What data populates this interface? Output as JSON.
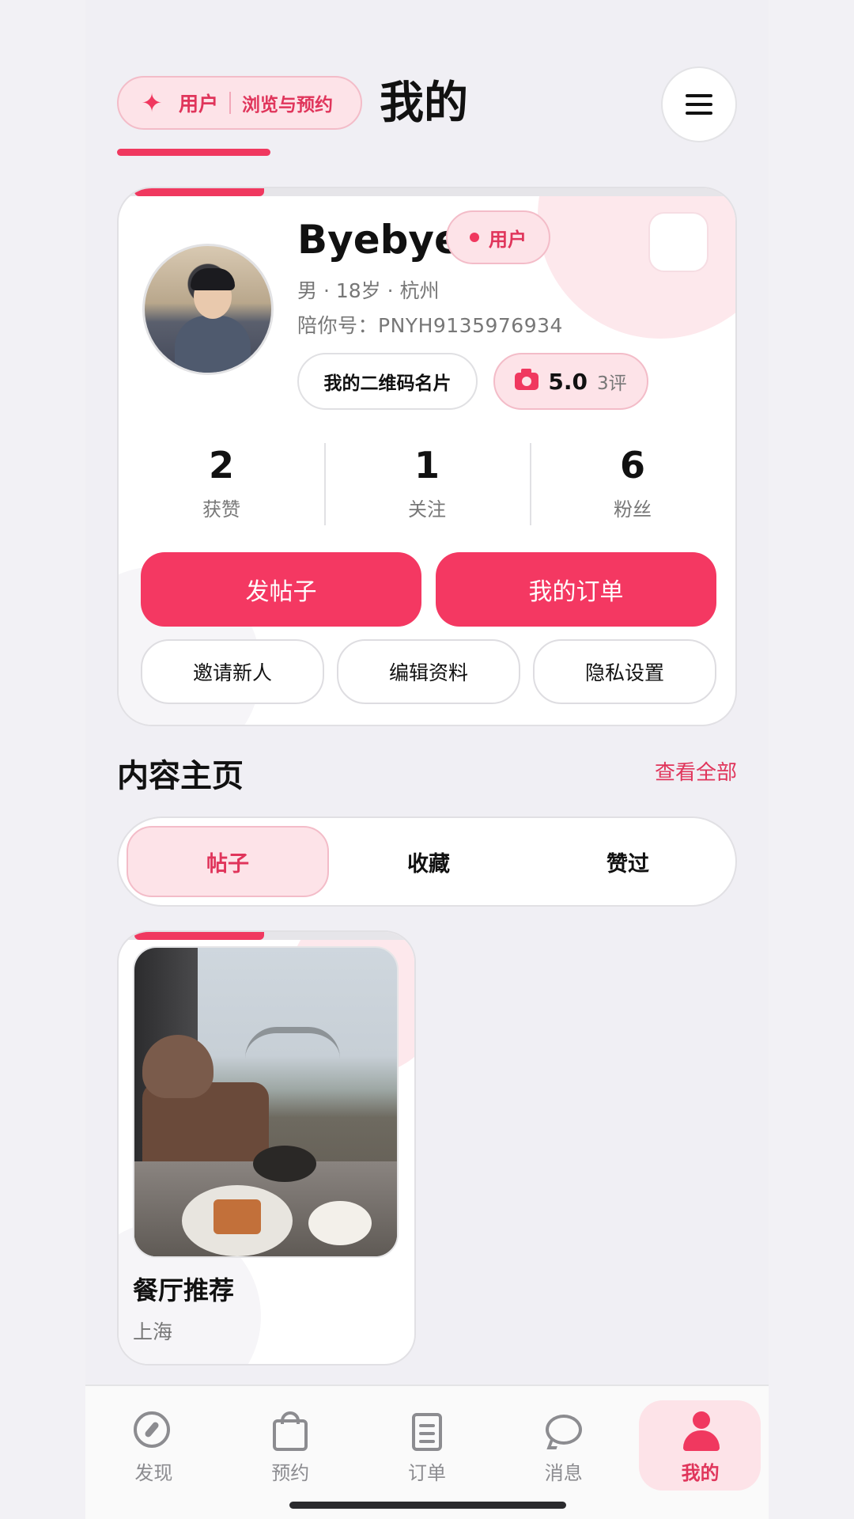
{
  "header": {
    "role_label": "用户",
    "role_sub": "浏览与预约",
    "title": "我的"
  },
  "profile": {
    "name": "Byebye",
    "badge": "用户",
    "meta": "男 · 18岁 · 杭州",
    "pid_label": "陪你号：",
    "pid_value": "PNYH9135976934",
    "qr_button": "我的二维码名片",
    "rating": "5.0",
    "rating_count": "3评",
    "stats": [
      {
        "num": "2",
        "label": "获赞"
      },
      {
        "num": "1",
        "label": "关注"
      },
      {
        "num": "6",
        "label": "粉丝"
      }
    ],
    "primary_buttons": [
      "发帖子",
      "我的订单"
    ],
    "secondary_buttons": [
      "邀请新人",
      "编辑资料",
      "隐私设置"
    ]
  },
  "content": {
    "title": "内容主页",
    "see_all": "查看全部",
    "tabs": [
      "帖子",
      "收藏",
      "赞过"
    ],
    "active_tab": "帖子",
    "posts": [
      {
        "title": "餐厅推荐",
        "location": "上海"
      }
    ]
  },
  "nav": {
    "items": [
      {
        "label": "发现",
        "icon": "compass-icon"
      },
      {
        "label": "预约",
        "icon": "shopping-bag-icon"
      },
      {
        "label": "订单",
        "icon": "document-icon"
      },
      {
        "label": "消息",
        "icon": "chat-bubble-icon"
      },
      {
        "label": "我的",
        "icon": "person-icon"
      }
    ],
    "active": "我的"
  },
  "colors": {
    "accent": "#f0385f",
    "accent_soft": "#fde3e8",
    "background": "#f0eff4"
  }
}
